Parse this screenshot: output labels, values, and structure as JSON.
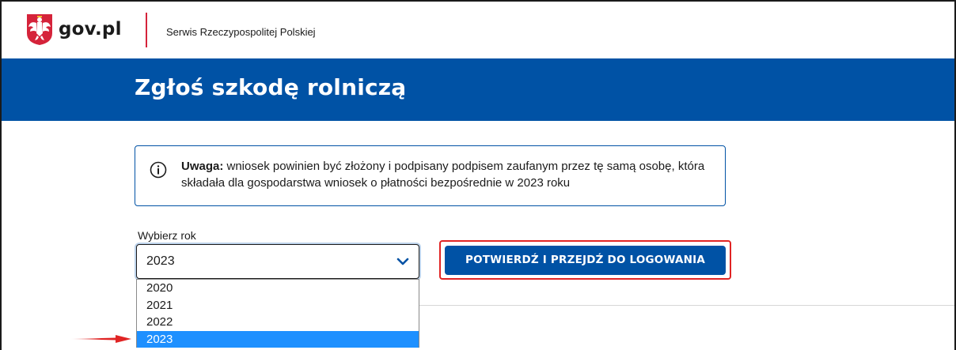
{
  "header": {
    "logo_text": "gov.pl",
    "service_name": "Serwis Rzeczypospolitej Polskiej",
    "emblem_icon": "polish-eagle-emblem-icon"
  },
  "banner": {
    "title": "Zgłoś szkodę rolniczą"
  },
  "alert": {
    "icon": "info-circle-icon",
    "bold_prefix": "Uwaga:",
    "text": " wniosek powinien być złożony i podpisany podpisem zaufanym przez tę samą osobę, która składała dla gospodarstwa wniosek o płatności bezpośrednie w 2023 roku"
  },
  "year_select": {
    "label": "Wybierz rok",
    "value": "2023",
    "options": [
      "2020",
      "2021",
      "2022",
      "2023"
    ],
    "selected_index": 3
  },
  "confirm_button": {
    "label": "POTWIERDŹ I PRZEJDŹ DO LOGOWANIA"
  },
  "colors": {
    "brand_blue": "#0052a5",
    "accent_red": "#d5233a",
    "highlight_red": "#e02424",
    "option_selected": "#1e90ff"
  }
}
